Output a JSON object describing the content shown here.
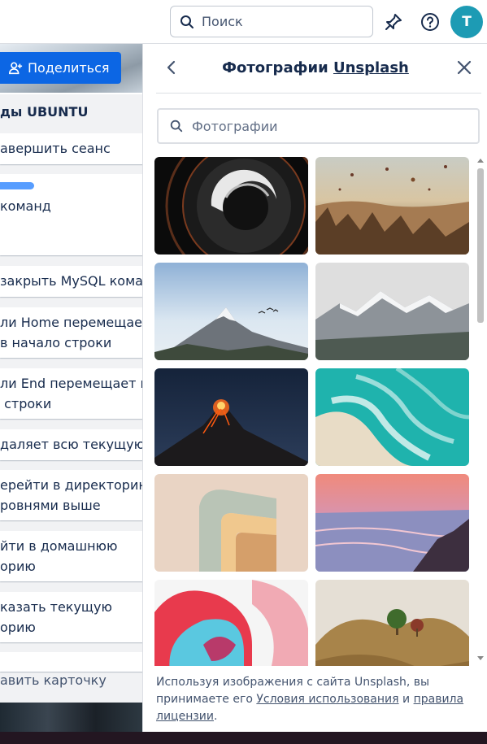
{
  "header": {
    "search_label": "Поиск",
    "avatar_initial": "T",
    "avatar_color": "#1d9bb4"
  },
  "board": {
    "share_label": "Поделиться",
    "list_title": "ды UBUNTU",
    "cards": [
      "авершить сеанс",
      "команд",
      "закрыть MySQL кома",
      "ли Home перемещает\nв начало строки",
      "ли End перемещает к\n строки",
      "даляет всю текущую с",
      "ерейти в директорию\nровнями выше",
      "йти в домашнюю\nорию",
      "казать текущую\nорию"
    ],
    "add_card_label": "авить карточку"
  },
  "panel": {
    "title_prefix": "Фотографии",
    "title_link": "Unsplash",
    "search_placeholder": "Фотографии",
    "footer_text_1": "Используя изображения с сайта Unsplash, вы принимаете его",
    "terms_link": "Условия использования",
    "and_text": "и",
    "license_link": "правила лицензии",
    "period": "."
  },
  "photos": [
    {
      "name": "photo-camera-lens"
    },
    {
      "name": "photo-cappadocia-balloons"
    },
    {
      "name": "photo-mountain-birds"
    },
    {
      "name": "photo-snowy-mountains"
    },
    {
      "name": "photo-volcano-night"
    },
    {
      "name": "photo-turquoise-waves"
    },
    {
      "name": "photo-abstract-shape"
    },
    {
      "name": "photo-pink-sea"
    },
    {
      "name": "photo-abstract-red-blue"
    },
    {
      "name": "photo-tree-hills"
    }
  ]
}
